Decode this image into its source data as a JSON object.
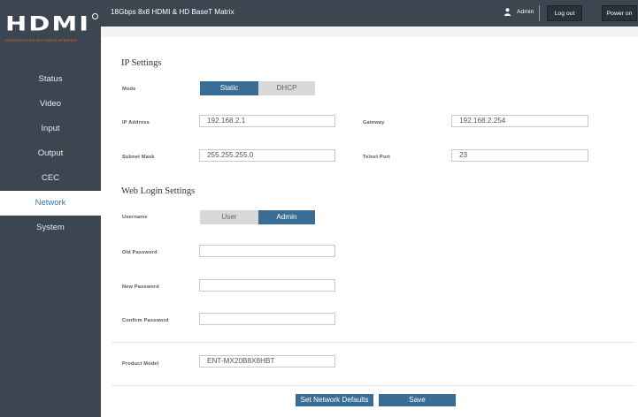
{
  "brand": {
    "logo_text": "HDMI",
    "logo_subtitle": "HIGH-DEFINITION MULTIMEDIA INTERFACE",
    "accent_color": "#e86b2a"
  },
  "topbar": {
    "title": "18Gbps 8x8 HDMI & HD BaseT Matrix",
    "user_label": "Admin",
    "logout_label": "Log out",
    "poweron_label": "Power on"
  },
  "sidebar": {
    "items": [
      {
        "label": "Status"
      },
      {
        "label": "Video"
      },
      {
        "label": "Input"
      },
      {
        "label": "Output"
      },
      {
        "label": "CEC"
      },
      {
        "label": "Network",
        "active": true
      },
      {
        "label": "System"
      }
    ]
  },
  "ip_settings": {
    "title": "IP Settings",
    "mode_label": "Mode",
    "mode_options": [
      "Static",
      "DHCP"
    ],
    "mode_selected": "Static",
    "ip_address_label": "IP Address",
    "ip_address": "192.168.2.1",
    "gateway_label": "Gateway",
    "gateway": "192.168.2.254",
    "subnet_mask_label": "Subnet Mask",
    "subnet_mask": "255.255.255.0",
    "telnet_port_label": "Telnet Port",
    "telnet_port": "23"
  },
  "web_login": {
    "title": "Web Login Settings",
    "username_label": "Username",
    "username_options": [
      "User",
      "Admin"
    ],
    "username_selected": "Admin",
    "old_password_label": "Old Password",
    "old_password": "",
    "new_password_label": "New Password",
    "new_password": "",
    "confirm_password_label": "Confirm Password",
    "confirm_password": ""
  },
  "product": {
    "model_label": "Product Model",
    "model": "ENT-MX20B8X8HBT"
  },
  "actions": {
    "defaults_label": "Set Network Defaults",
    "save_label": "Save"
  },
  "colors": {
    "sidebar_bg": "#3b4650",
    "active_blue": "#3a6d96",
    "active_nav_text": "#3a78a8"
  }
}
